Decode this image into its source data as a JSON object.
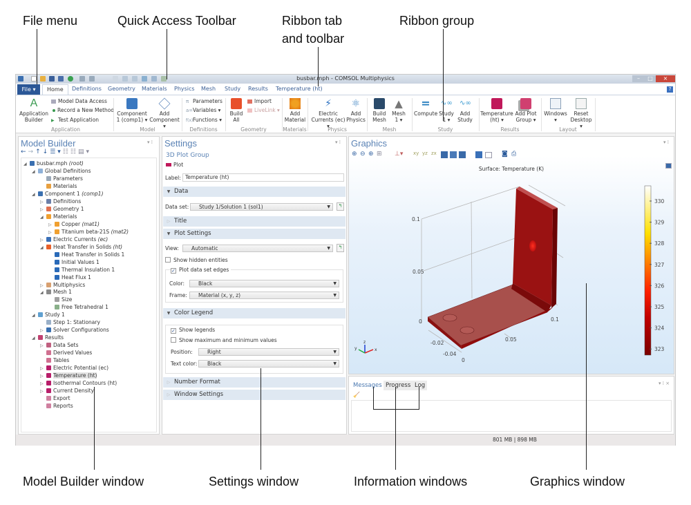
{
  "annotations": {
    "file_menu": "File menu",
    "quick_access_toolbar": "Quick Access Toolbar",
    "ribbon_tab_line1": "Ribbon tab",
    "ribbon_tab_line2": "and toolbar",
    "ribbon_group": "Ribbon group",
    "model_builder_window": "Model Builder window",
    "settings_window": "Settings window",
    "information_windows": "Information windows",
    "graphics_window": "Graphics window"
  },
  "window": {
    "title": "busbar.mph - COMSOL Multiphysics",
    "help": "?"
  },
  "ribbon": {
    "file_label": "File ▾",
    "tabs": [
      "Home",
      "Definitions",
      "Geometry",
      "Materials",
      "Physics",
      "Mesh",
      "Study",
      "Results",
      "Temperature (ht)"
    ],
    "groups": [
      "Application",
      "Model",
      "Definitions",
      "Geometry",
      "Materials",
      "Physics",
      "Mesh",
      "Study",
      "Results",
      "Layout"
    ],
    "application": {
      "builder": "Application Builder",
      "model_data_access": "Model Data Access",
      "record_method": "Record a New Method",
      "test_application": "Test Application"
    },
    "model": {
      "component": "Component 1 (comp1) ▾",
      "add_component": "Add Component ▾"
    },
    "definitions": {
      "parameters": "Parameters",
      "variables": "Variables ▾",
      "functions": "Functions ▾"
    },
    "geometry": {
      "build_all": "Build All",
      "import": "Import",
      "livelink": "LiveLink ▾"
    },
    "materials": {
      "add_material": "Add Material"
    },
    "physics": {
      "electric_currents": "Electric Currents (ec) ▾",
      "add_physics": "Add Physics"
    },
    "mesh": {
      "build_mesh": "Build Mesh",
      "mesh1": "Mesh 1 ▾"
    },
    "study": {
      "compute": "Compute",
      "study1": "Study 1 ▾",
      "add_study": "Add Study"
    },
    "results": {
      "temperature": "Temperature (ht) ▾",
      "add_plot_group": "Add Plot Group ▾"
    },
    "layout": {
      "windows": "Windows ▾",
      "reset_desktop": "Reset Desktop ▾"
    }
  },
  "model_builder": {
    "title": "Model Builder",
    "toolbar_icons": [
      "arrow-left",
      "arrow-right",
      "arrow-up",
      "arrow-down",
      "show-menu",
      "expand",
      "collapse",
      "view-menu"
    ],
    "tree": [
      {
        "level": 0,
        "exp": "open",
        "icon": "#3a6fb0",
        "label": "busbar.mph ",
        "italic": "(root)"
      },
      {
        "level": 1,
        "exp": "open",
        "icon": "#8fb1d8",
        "label": "Global Definitions"
      },
      {
        "level": 2,
        "exp": "",
        "icon": "#9aa8b8",
        "label": "Parameters"
      },
      {
        "level": 2,
        "exp": "",
        "icon": "#e8a040",
        "label": "Materials"
      },
      {
        "level": 1,
        "exp": "open",
        "icon": "#3a6fb0",
        "label": "Component 1 ",
        "italic": "(comp1)"
      },
      {
        "level": 2,
        "exp": "closed",
        "icon": "#6b7fa8",
        "label": "Definitions"
      },
      {
        "level": 2,
        "exp": "closed",
        "icon": "#e07050",
        "label": "Geometry 1"
      },
      {
        "level": 2,
        "exp": "open",
        "icon": "#f0a030",
        "label": "Materials"
      },
      {
        "level": 3,
        "exp": "closed",
        "icon": "#f0a030",
        "label": "Copper ",
        "italic": "(mat1)"
      },
      {
        "level": 3,
        "exp": "closed",
        "icon": "#f0a030",
        "label": "Titanium beta-21S ",
        "italic": "(mat2)"
      },
      {
        "level": 2,
        "exp": "closed",
        "icon": "#3a70b8",
        "label": "Electric Currents ",
        "italic": "(ec)"
      },
      {
        "level": 2,
        "exp": "open",
        "icon": "#e8602a",
        "label": "Heat Transfer in Solids ",
        "italic": "(ht)"
      },
      {
        "level": 3,
        "exp": "",
        "icon": "#2a6ab8",
        "label": "Heat Transfer in Solids 1"
      },
      {
        "level": 3,
        "exp": "",
        "icon": "#2a6ab8",
        "label": "Initial Values 1"
      },
      {
        "level": 3,
        "exp": "",
        "icon": "#2a6ab8",
        "label": "Thermal Insulation 1"
      },
      {
        "level": 3,
        "exp": "",
        "icon": "#2a6ab8",
        "label": "Heat Flux 1"
      },
      {
        "level": 2,
        "exp": "closed",
        "icon": "#d8a070",
        "label": "Multiphysics"
      },
      {
        "level": 2,
        "exp": "open",
        "icon": "#8a8a8a",
        "label": "Mesh 1"
      },
      {
        "level": 3,
        "exp": "",
        "icon": "#a0a0a0",
        "label": "Size"
      },
      {
        "level": 3,
        "exp": "",
        "icon": "#8ab08a",
        "label": "Free Tetrahedral 1"
      },
      {
        "level": 1,
        "exp": "open",
        "icon": "#60a0d0",
        "label": "Study 1"
      },
      {
        "level": 2,
        "exp": "",
        "icon": "#9ab0c8",
        "label": "Step 1: Stationary"
      },
      {
        "level": 2,
        "exp": "closed",
        "icon": "#3a70b0",
        "label": "Solver Configurations"
      },
      {
        "level": 1,
        "exp": "open",
        "icon": "#c04070",
        "label": "Results"
      },
      {
        "level": 2,
        "exp": "closed",
        "icon": "#c06080",
        "label": "Data Sets"
      },
      {
        "level": 2,
        "exp": "",
        "icon": "#d07090",
        "label": "Derived Values"
      },
      {
        "level": 2,
        "exp": "",
        "icon": "#d07090",
        "label": "Tables"
      },
      {
        "level": 2,
        "exp": "closed",
        "icon": "#b81e6a",
        "label": "Electric Potential (ec)"
      },
      {
        "level": 2,
        "exp": "closed",
        "icon": "#b81e6a",
        "label": "Temperature (ht)",
        "selected": true
      },
      {
        "level": 2,
        "exp": "closed",
        "icon": "#b81e6a",
        "label": "Isothermal Contours (ht)"
      },
      {
        "level": 2,
        "exp": "closed",
        "icon": "#b81e6a",
        "label": "Current Density"
      },
      {
        "level": 2,
        "exp": "",
        "icon": "#d080a0",
        "label": "Export"
      },
      {
        "level": 2,
        "exp": "",
        "icon": "#d080a0",
        "label": "Reports"
      }
    ]
  },
  "settings": {
    "title": "Settings",
    "subtitle": "3D Plot Group",
    "node": "Plot",
    "label_caption": "Label:",
    "label_value": "Temperature (ht)",
    "sections": {
      "data": "Data",
      "title": "Title",
      "plot_settings": "Plot Settings",
      "color_legend": "Color Legend",
      "number_format": "Number Format",
      "window_settings": "Window Settings"
    },
    "data_set_caption": "Data set:",
    "data_set_value": "Study 1/Solution 1 (sol1)",
    "view_caption": "View:",
    "view_value": "Automatic",
    "show_hidden": {
      "label": "Show hidden entities",
      "checked": false
    },
    "plot_edges": {
      "label": "Plot data set edges",
      "checked": true
    },
    "color_caption": "Color:",
    "color_value": "Black",
    "frame_caption": "Frame:",
    "frame_value": "Material  (x, y, z)",
    "show_legends": {
      "label": "Show legends",
      "checked": true
    },
    "show_minmax": {
      "label": "Show maximum and minimum values",
      "checked": false
    },
    "position_caption": "Position:",
    "position_value": "Right",
    "text_color_caption": "Text color:",
    "text_color_value": "Black"
  },
  "graphics": {
    "title": "Graphics",
    "plot_title": "Surface: Temperature (K)",
    "axis_ticks": {
      "z": [
        "0.1",
        "0.05",
        "0"
      ],
      "x": [
        "0.1",
        "0.05",
        "0"
      ],
      "y": [
        "-0.02",
        "-0.04"
      ]
    },
    "triad": {
      "x": "x",
      "y": "y",
      "z": "z"
    },
    "colorbar": {
      "ticks": [
        "330",
        "329",
        "328",
        "327",
        "326",
        "325",
        "324",
        "323"
      ],
      "colors": [
        "#7a0000",
        "#c00000",
        "#ff2000",
        "#ff8000",
        "#ffe000",
        "#ffffff"
      ]
    }
  },
  "messages": {
    "tabs": [
      "Messages",
      "Progress",
      "Log"
    ],
    "active": "Messages"
  },
  "status": {
    "memory": "801 MB | 898 MB"
  }
}
